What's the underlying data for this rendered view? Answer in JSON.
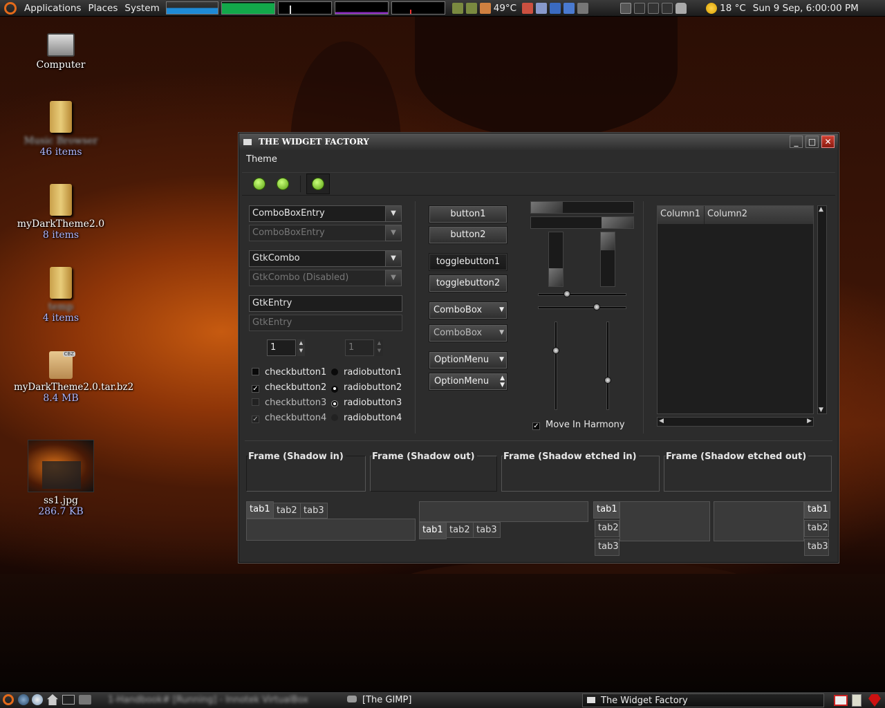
{
  "top_panel": {
    "menus": [
      "Applications",
      "Places",
      "System"
    ],
    "cpu_temp": "49°C",
    "weather": "18 °C",
    "clock": "Sun  9 Sep,  6:00:00 PM"
  },
  "desktop": {
    "icons": [
      {
        "label": "Computer"
      },
      {
        "label": "Music Browser",
        "sub": "46 items"
      },
      {
        "label": "myDarkTheme2.0",
        "sub": "8 items"
      },
      {
        "label": "temp",
        "sub": "4 items"
      },
      {
        "label": "myDarkTheme2.0.tar.bz2",
        "sub": "8.4 MB",
        "badge": "CBZ"
      },
      {
        "label": "ss1.jpg",
        "sub": "286.7 KB"
      }
    ]
  },
  "window": {
    "title": "THE WIDGET FACTORY",
    "menu_theme": "Theme",
    "combo_entry1": "ComboBoxEntry",
    "combo_entry2": "ComboBoxEntry",
    "gtk_combo": "GtkCombo",
    "gtk_combo_disabled": "GtkCombo (Disabled)",
    "entry1": "GtkEntry",
    "entry2": "GtkEntry",
    "spin1": "1",
    "spin2": "1",
    "checks": [
      "checkbutton1",
      "checkbutton2",
      "checkbutton3",
      "checkbutton4"
    ],
    "radios": [
      "radiobutton1",
      "radiobutton2",
      "radiobutton3",
      "radiobutton4"
    ],
    "buttons": [
      "button1",
      "button2"
    ],
    "toggles": [
      "togglebutton1",
      "togglebutton2"
    ],
    "combos": [
      "ComboBox",
      "ComboBox"
    ],
    "option_menus": [
      "OptionMenu",
      "OptionMenu"
    ],
    "move_in_harmony": "Move In Harmony",
    "columns": [
      "Column1",
      "Column2"
    ],
    "frames": [
      "Frame (Shadow in)",
      "Frame (Shadow out)",
      "Frame (Shadow etched in)",
      "Frame (Shadow etched out)"
    ],
    "tabs": [
      "tab1",
      "tab2",
      "tab3"
    ]
  },
  "taskbar": {
    "tasks": [
      "1-Handbook# [Running] - Innotek VirtualBox",
      "[The GIMP]",
      "The Widget Factory"
    ]
  }
}
